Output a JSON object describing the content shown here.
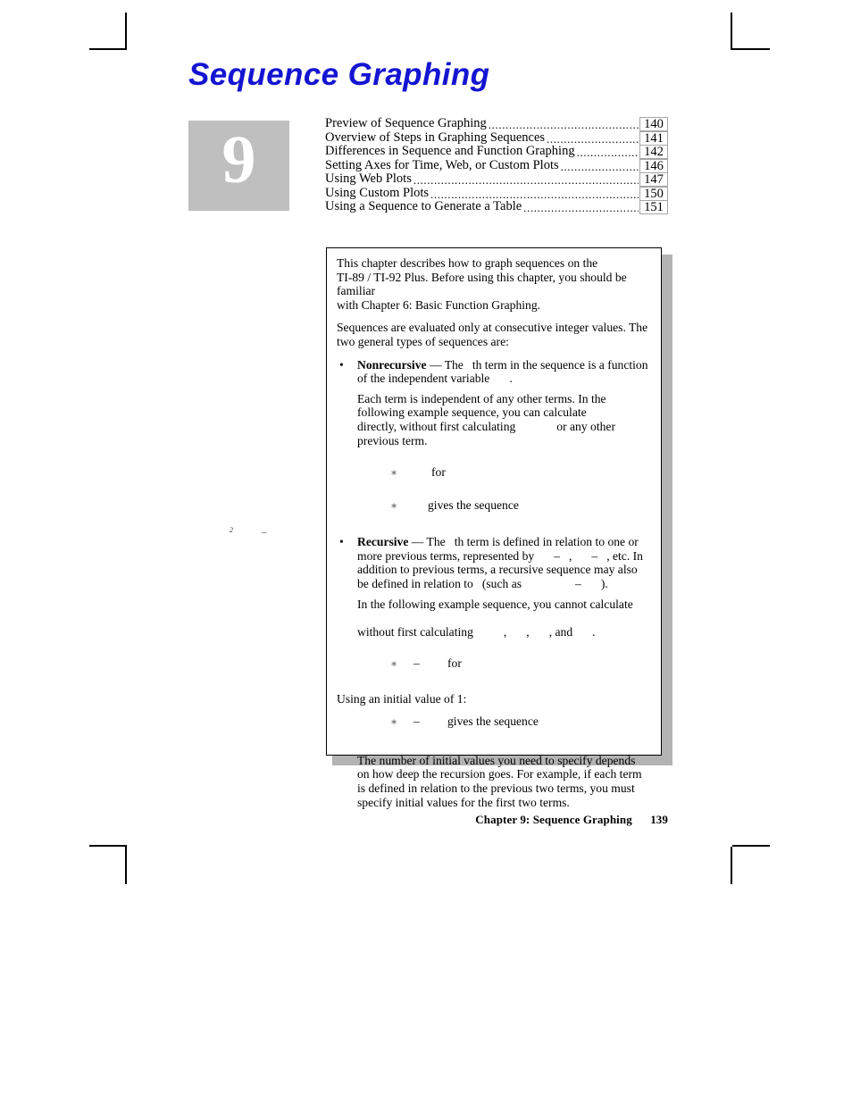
{
  "document": {
    "chapter_number": "9",
    "title": "Sequence Graphing"
  },
  "toc": {
    "entries": [
      {
        "label": "Preview of Sequence Graphing",
        "page": "140",
        "dots": "...................................................................."
      },
      {
        "label": "Overview of Steps in Graphing Sequences",
        "page": "141",
        "dots": "......................................."
      },
      {
        "label": "Differences in Sequence and Function Graphing",
        "page": "142",
        "dots": "........................."
      },
      {
        "label": "Setting Axes for Time, Web, or Custom Plots",
        "page": "146",
        "dots": ".............................."
      },
      {
        "label": "Using Web Plots",
        "page": "147",
        "dots": "..............................................................................."
      },
      {
        "label": "Using Custom Plots",
        "page": "150",
        "dots": "........................................................................"
      },
      {
        "label": "Using a Sequence to Generate a Table",
        "page": "151",
        "dots": "......................................."
      }
    ]
  },
  "content": {
    "intro": {
      "line1": "This chapter describes how to graph sequences on the",
      "line2_a": "TI",
      "line2_hyphen1": "-",
      "line2_b": "89 / TI",
      "line2_hyphen2": "-",
      "line2_c": "92 Plus",
      "line2_d": ". Before using this chapter, you should be familiar",
      "line3": "with Chapter 6: Basic Function Graphing."
    },
    "paragraph2": "Sequences are evaluated only at consecutive integer values. The two general types of sequences are:",
    "nonrecursive": {
      "bullet": "•",
      "lead": "Nonrecursive",
      "dash": "—",
      "text_a": "The",
      "text_b": "th term in the sequence is a function of the independent variable",
      "text_c": "."
    },
    "nonrecursive_detail": {
      "text_a": "Each term is independent of any other terms. In the following example sequence, you can calculate",
      "text_b": "directly, without first calculating",
      "text_c": "or any other previous term."
    },
    "equations_nonrecursive": [
      {
        "asterisk": "∗",
        "word": "for"
      },
      {
        "asterisk": "∗",
        "word": "gives the sequence"
      }
    ],
    "recursive": {
      "bullet": "•",
      "lead": "Recursive",
      "dash": "—",
      "text_a": "The",
      "text_b": "th term is defined in relation to one or more previous terms, represented by",
      "minus1": "–",
      "comma1": ",",
      "minus2": "–",
      "comma2": ", etc. In addition to previous terms, a recursive sequence may also be defined in relation to",
      "text_c": "(such as",
      "minus3": "–",
      "text_d": ")."
    },
    "recursive_detail": {
      "text_a": "In the following example sequence, you cannot calculate",
      "text_b": "without first calculating",
      "comma1": ",",
      "comma2": ",",
      "comma3": ", and",
      "period": "."
    },
    "equations_recursive_1": {
      "asterisk": "∗",
      "minus": "–",
      "word": "for"
    },
    "initial_value_note": "Using an initial value of 1:",
    "equations_recursive_2": {
      "asterisk": "∗",
      "minus": "–",
      "word": "gives the sequence"
    },
    "closing": "The number of initial values you need to specify depends on how deep the recursion goes. For example, if each term is defined in relation to the previous two terms, you must specify initial values for the first two terms."
  },
  "margin_orphans": {
    "superscript_two": "2",
    "dash": "–"
  },
  "footer": {
    "text": "Chapter 9: Sequence Graphing",
    "page": "139"
  },
  "colors": {
    "title": "#1414d2",
    "badge_background": "#bfbfbf",
    "badge_number": "#ffffff",
    "shadow": "#b3b3b3",
    "toc_box_border": "#a6a6a6"
  }
}
